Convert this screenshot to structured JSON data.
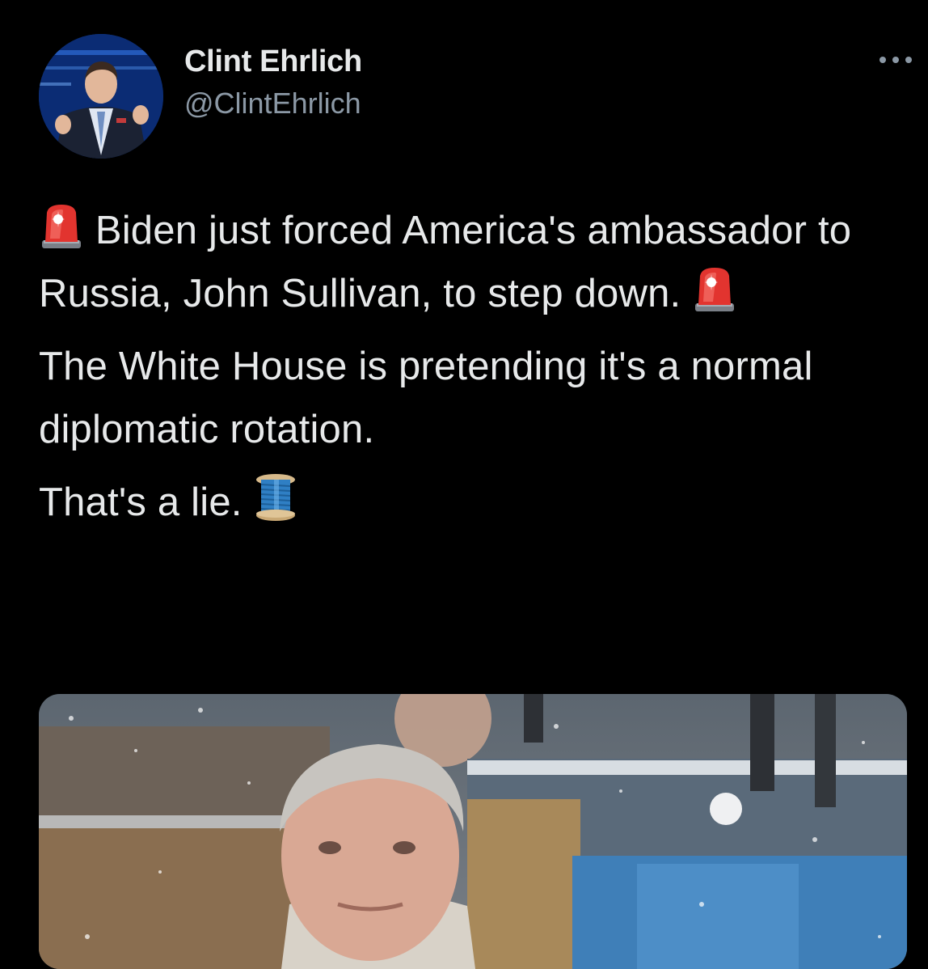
{
  "author": {
    "display_name": "Clint Ehrlich",
    "handle": "@ClintEhrlich",
    "avatar_icon": "profile-photo"
  },
  "more_icon": "more-dots-icon",
  "tweet": {
    "line1": "Biden just forced America's ambassador to Russia, John Sullivan, to step down.",
    "line1_lead_emoji": "police-car-light-icon",
    "line1_trail_emoji": "police-car-light-icon",
    "line2": "The White House is pretending it's a normal diplomatic rotation.",
    "line3": "That's a lie.",
    "line3_trail_emoji": "thread-spool-icon"
  },
  "media": {
    "description_icon": "photo-attachment"
  },
  "colors": {
    "background": "#000000",
    "text_primary": "#e7e9ea",
    "text_secondary": "#8b98a5"
  }
}
